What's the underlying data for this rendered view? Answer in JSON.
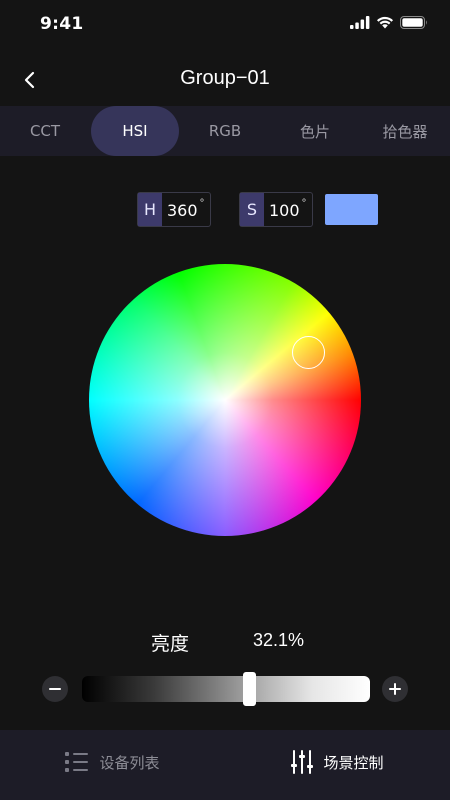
{
  "status": {
    "time": "9:41"
  },
  "header": {
    "title": "Group−01"
  },
  "tabs": [
    {
      "label": "CCT",
      "active": false
    },
    {
      "label": "HSI",
      "active": true
    },
    {
      "label": "RGB",
      "active": false
    },
    {
      "label": "色片",
      "active": false
    },
    {
      "label": "拾色器",
      "active": false
    }
  ],
  "hue": {
    "tag": "H",
    "value": "360",
    "unit": "°"
  },
  "saturation": {
    "tag": "S",
    "value": "100",
    "unit": "°"
  },
  "swatch_color": "#7ea6ff",
  "brightness": {
    "label": "亮度",
    "value": "32.1%",
    "fraction": 0.58
  },
  "bottom_nav": [
    {
      "label": "设备列表",
      "icon": "list-icon",
      "active": false
    },
    {
      "label": "场景控制",
      "icon": "sliders-icon",
      "active": true
    }
  ]
}
